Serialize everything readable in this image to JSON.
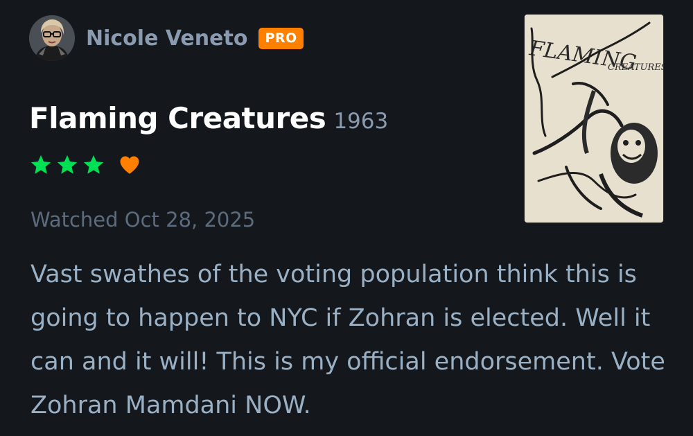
{
  "user": {
    "name": "Nicole Veneto",
    "badge": "PRO",
    "avatar_icon": "user-avatar"
  },
  "film": {
    "title": "Flaming Creatures",
    "year": "1963",
    "poster_text_line1": "FLAMING",
    "poster_text_line2": "CREATURES"
  },
  "rating": {
    "stars": 3,
    "max_stars": 5,
    "liked": true,
    "star_color": "#00e054",
    "heart_color": "#ff8000"
  },
  "watched_label": "Watched Oct 28, 2025",
  "review": {
    "text": "Vast swathes of the voting population think this is going to happen to NYC if Zohran is elected. Well it can and it will! This is my official endorsement. Vote Zohran Mamdani NOW."
  },
  "colors": {
    "background": "#14181c",
    "pro_badge": "#ff8000"
  }
}
